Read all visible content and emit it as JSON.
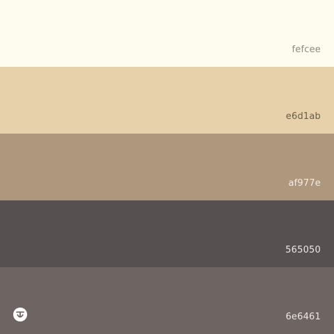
{
  "palette": {
    "swatches": [
      {
        "hex": "#fefcee",
        "label": "fefcee"
      },
      {
        "hex": "#e6d1ab",
        "label": "e6d1ab"
      },
      {
        "hex": "#af977e",
        "label": "af977e"
      },
      {
        "hex": "#565050",
        "label": "565050"
      },
      {
        "hex": "#6e6461",
        "label": "6e6461"
      }
    ]
  },
  "logo": {
    "icon": "brand-logo-icon"
  }
}
